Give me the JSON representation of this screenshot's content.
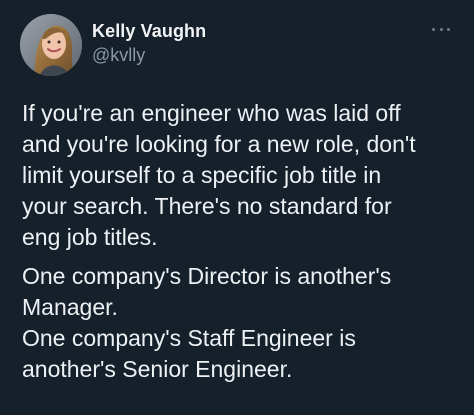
{
  "tweet": {
    "author": {
      "name": "Kelly Vaughn",
      "handle": "@kvlly",
      "avatar_icon": "profile-photo",
      "more_icon": "more-options-icon"
    },
    "paragraphs": [
      [
        "If you're an engineer who was laid off",
        "and you're looking for a new role, don't",
        "limit yourself to a specific job title in",
        "your search. There's no standard for",
        "eng job titles."
      ],
      [
        "One company's Director is another's",
        "Manager.",
        "One company's Staff Engineer is",
        "another's Senior Engineer."
      ]
    ]
  }
}
